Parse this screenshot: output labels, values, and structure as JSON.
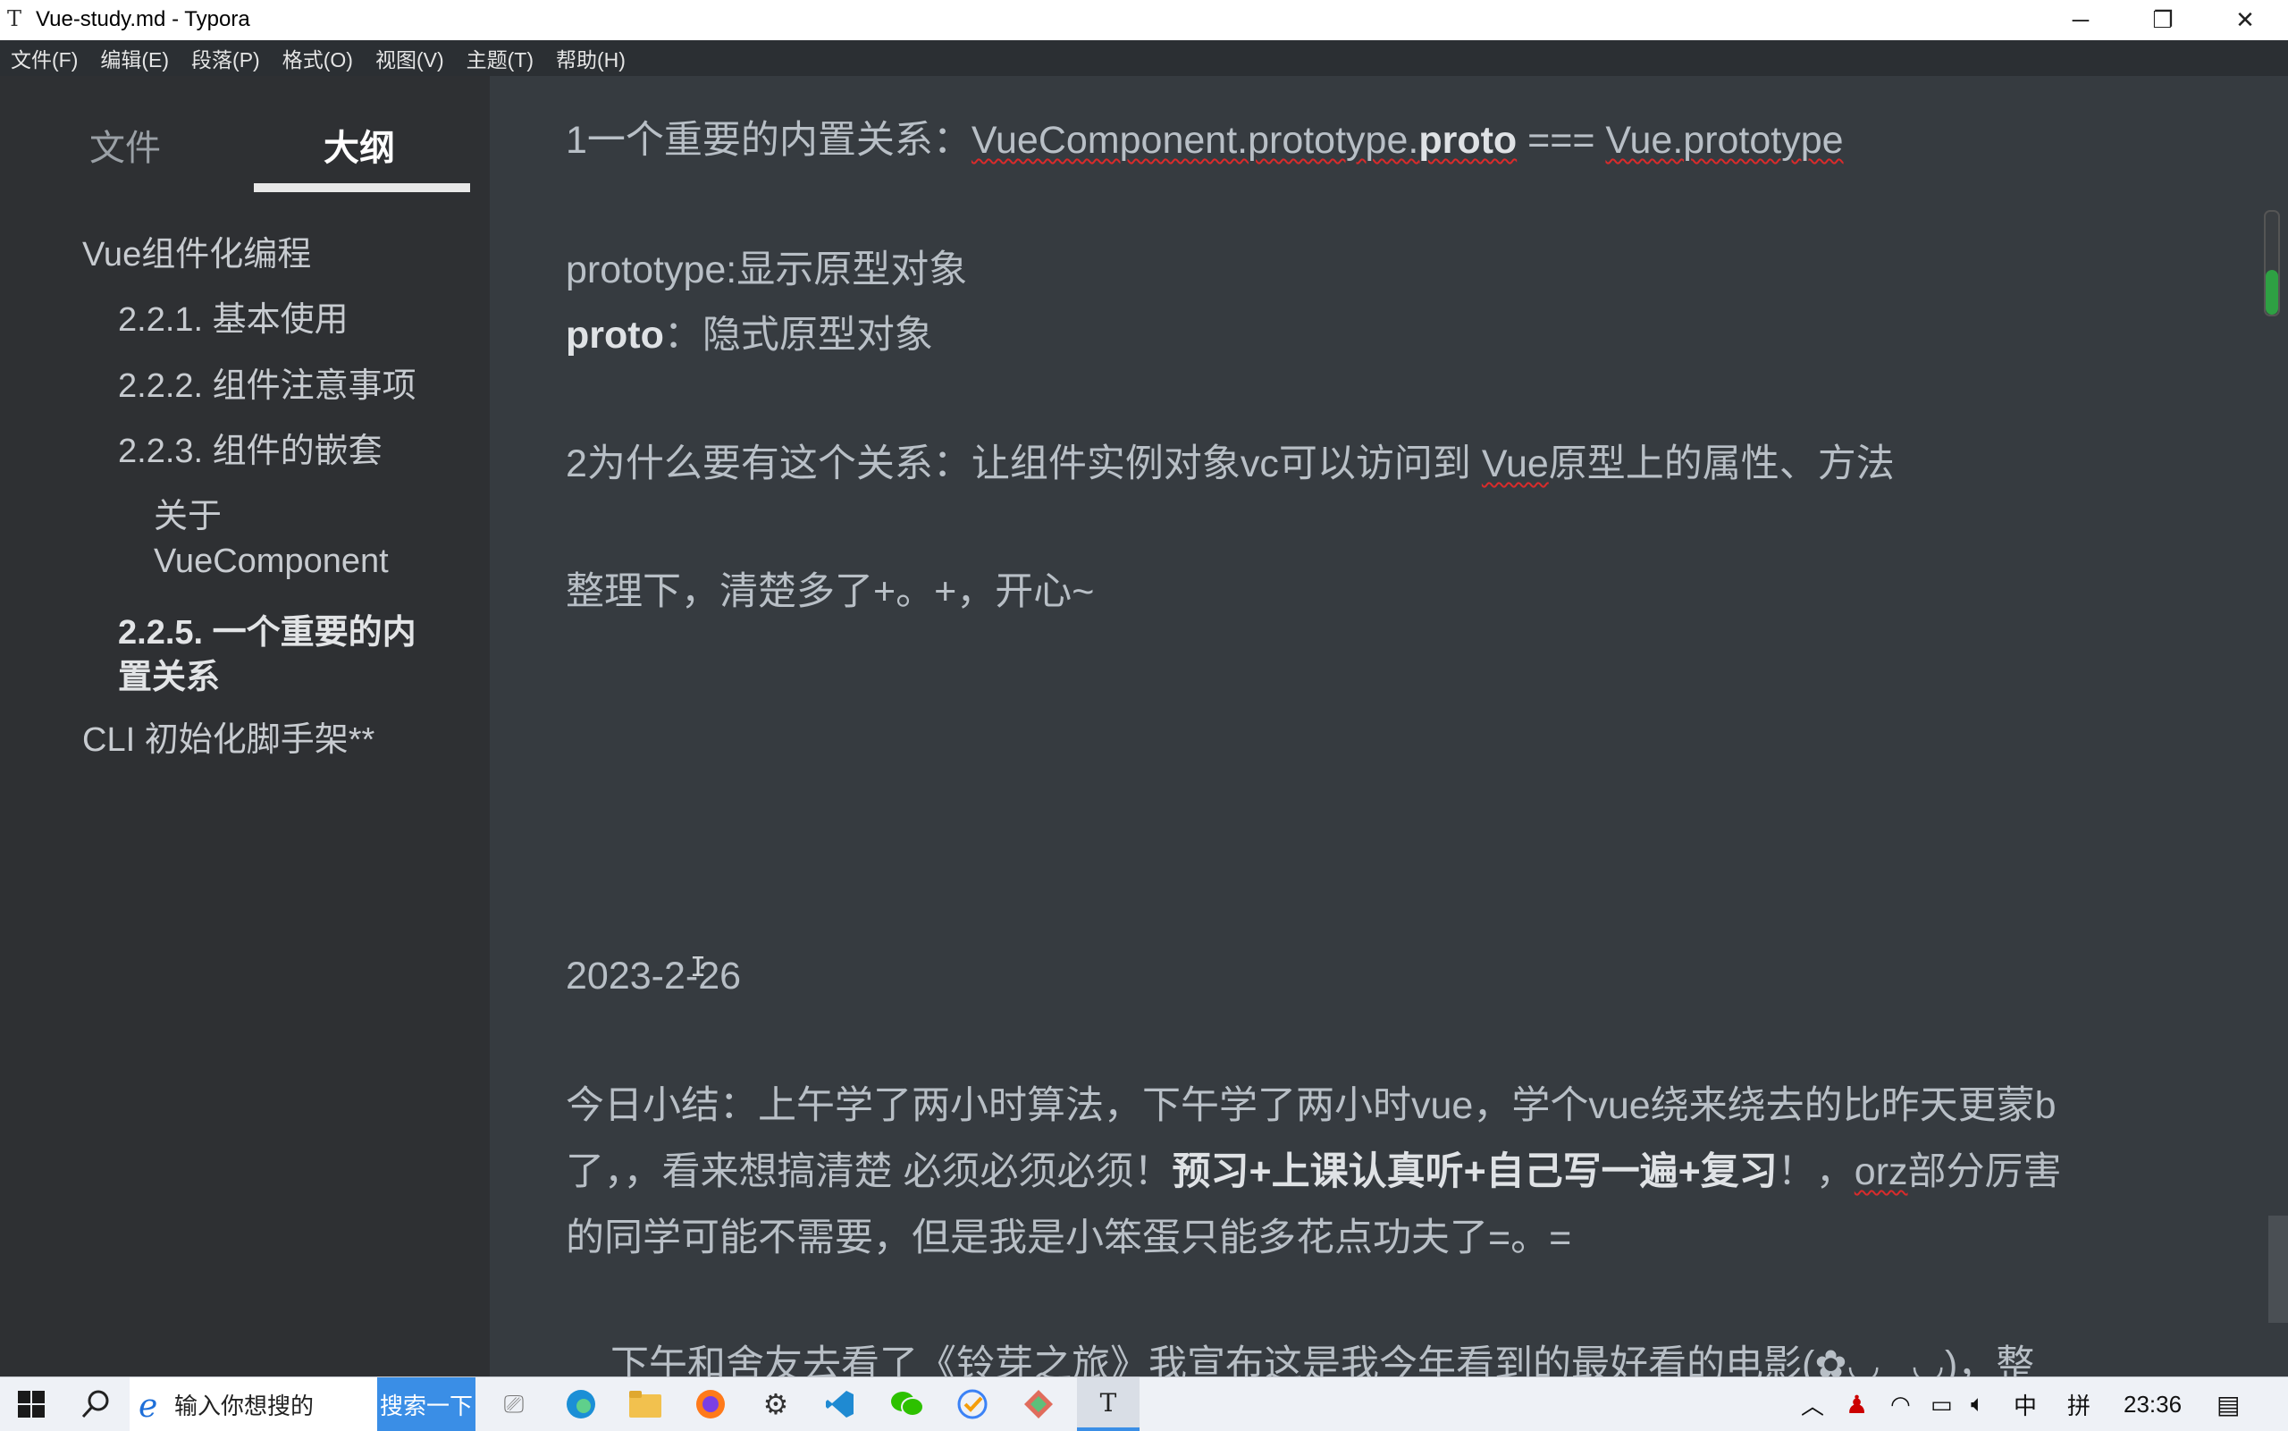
{
  "window": {
    "app_icon": "T",
    "title": "Vue-study.md - Typora",
    "controls": {
      "minimize": "─",
      "maximize": "❐",
      "close": "✕"
    }
  },
  "menu": [
    "文件(F)",
    "编辑(E)",
    "段落(P)",
    "格式(O)",
    "视图(V)",
    "主题(T)",
    "帮助(H)"
  ],
  "sidebar": {
    "tabs": {
      "files": "文件",
      "outline": "大纲"
    },
    "outline": [
      {
        "label": "Vue组件化编程"
      },
      {
        "label": "2.2.1. 基本使用"
      },
      {
        "label": "2.2.2. 组件注意事项"
      },
      {
        "label": "2.2.3. 组件的嵌套"
      },
      {
        "label_line1": "关于",
        "label_line2": "VueComponent"
      },
      {
        "label_line1": "2.2.5. 一个重要的内",
        "label_line2": "置关系"
      },
      {
        "label": "CLI 初始化脚手架**"
      }
    ]
  },
  "document": {
    "p1": {
      "prefix": "1一个重要的内置关系：",
      "link1": "VueComponent.prototype.",
      "bold": "proto",
      "mid": " === ",
      "link2": "Vue.prototype"
    },
    "p2": "prototype:显示原型对象",
    "p3": {
      "bold": "proto",
      "rest": "：隐式原型对象"
    },
    "p4": {
      "prefix": "2为什么要有这个关系：让组件实例对象vc可以访问到 ",
      "underlined": "Vue",
      "suffix": "原型上的属性、方法"
    },
    "p5": "整理下，清楚多了+。+，开心~",
    "date": "2023-2-26",
    "summary": {
      "line1": "今日小结：上午学了两小时算法，下午学了两小时vue，学个vue绕来绕去的比昨天更蒙b",
      "line2_start": "了，，看来想搞清楚 必须必须必须！",
      "line2_bold": "预习+上课认真听+自己写一遍+复习",
      "line2_mid": "！，",
      "line2_underlined": "orz",
      "line2_end": "部分厉害",
      "line3": "的同学可能不需要，但是我是小笨蛋只能多花点功夫了=。="
    },
    "cutoff_line": "下午和舍友去看了《铃芽之旅》我宣布这是我今年看到的最好看的电影(✿◡‿◡)，整"
  },
  "taskbar": {
    "search_placeholder": "输入你想搜的",
    "search_button": "搜索一下",
    "tray": {
      "ime_lang": "中",
      "ime_mode": "拼",
      "time": "23:36"
    }
  }
}
